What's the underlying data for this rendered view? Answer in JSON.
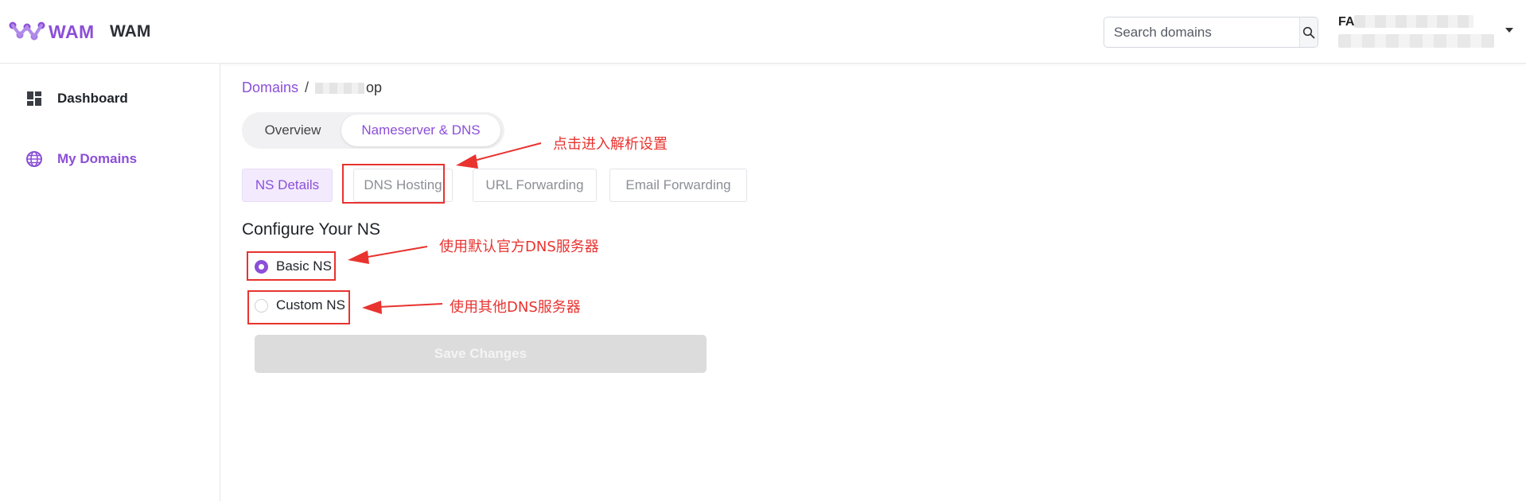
{
  "header": {
    "logo_text": "WAM",
    "app_name": "WAM",
    "search_placeholder": "Search domains",
    "user_name_visible": "FA",
    "colors": {
      "brand": "#8b4fd8"
    }
  },
  "sidebar": {
    "items": [
      {
        "label": "Dashboard",
        "icon": "dashboard-icon",
        "active": false
      },
      {
        "label": "My Domains",
        "icon": "globe-icon",
        "active": true
      }
    ]
  },
  "breadcrumb": {
    "root": "Domains",
    "separator": "/",
    "current_visible": "op"
  },
  "segmented": {
    "items": [
      {
        "label": "Overview",
        "active": false
      },
      {
        "label": "Nameserver & DNS",
        "active": true
      }
    ]
  },
  "tabs": [
    {
      "label": "NS Details",
      "active": true
    },
    {
      "label": "DNS Hosting",
      "active": false
    },
    {
      "label": "URL Forwarding",
      "active": false
    },
    {
      "label": "Email Forwarding",
      "active": false
    }
  ],
  "section": {
    "title": "Configure Your NS",
    "options": [
      {
        "label": "Basic NS",
        "checked": true
      },
      {
        "label": "Custom NS",
        "checked": false
      }
    ],
    "save_label": "Save Changes",
    "save_disabled": true
  },
  "annotations": {
    "dns_hosting_note": "点击进入解析设置",
    "basic_ns_note": "使用默认官方DNS服务器",
    "custom_ns_note": "使用其他DNS服务器",
    "color": "#e8332f"
  }
}
